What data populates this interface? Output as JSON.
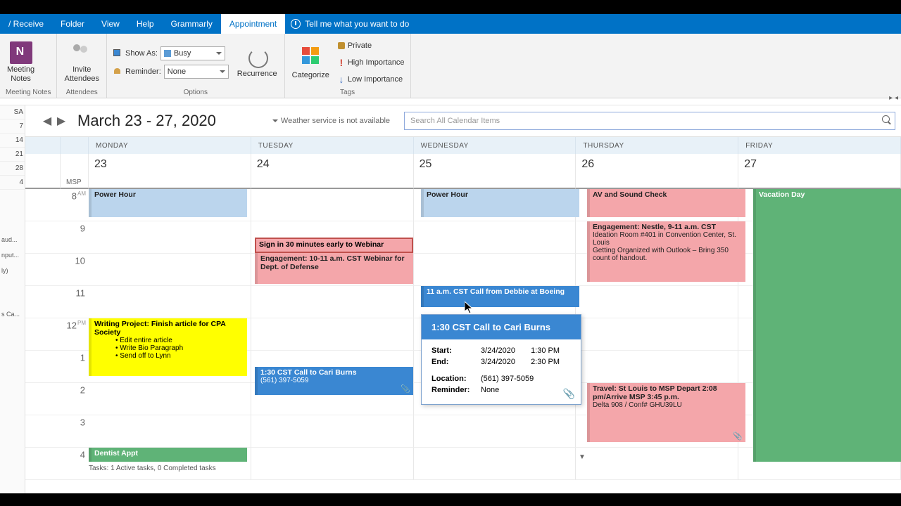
{
  "ribbon_tabs": {
    "send_receive": " / Receive",
    "folder": "Folder",
    "view": "View",
    "help": "Help",
    "grammarly": "Grammarly",
    "appointment": "Appointment",
    "tell_me": "Tell me what you want to do"
  },
  "ribbon": {
    "meeting_notes": "Meeting\nNotes",
    "meeting_notes_group": "Meeting Notes",
    "invite_attendees": "Invite\nAttendees",
    "attendees_group": "Attendees",
    "show_as_label": "Show As:",
    "show_as_value": "Busy",
    "reminder_label": "Reminder:",
    "reminder_value": "None",
    "recurrence": "Recurrence",
    "options_group": "Options",
    "categorize": "Categorize",
    "private": "Private",
    "high_importance": "High Importance",
    "low_importance": "Low Importance",
    "tags_group": "Tags"
  },
  "left": {
    "sa": "SA",
    "d7": "7",
    "d14": "14",
    "d21": "21",
    "d28": "28",
    "d4": "4",
    "aud": "aud...",
    "nput": "nput...",
    "ly": "ly)",
    "sca": "s Ca..."
  },
  "calendar": {
    "title": "March 23 - 27, 2020",
    "weather": "Weather service is not available",
    "search_placeholder": "Search All Calendar Items",
    "tz": "MSP",
    "days": {
      "mon": "MONDAY",
      "tue": "TUESDAY",
      "wed": "WEDNESDAY",
      "thu": "THURSDAY",
      "fri": "FRIDAY",
      "d23": "23",
      "d24": "24",
      "d25": "25",
      "d26": "26",
      "d27": "27"
    },
    "hours": {
      "h8": "8",
      "h9": "9",
      "h10": "10",
      "h11": "11",
      "h12": "12",
      "h1": "1",
      "h2": "2",
      "h3": "3",
      "h4": "4",
      "am": "AM",
      "pm": "PM"
    },
    "events": {
      "power_hour": "Power Hour",
      "signin": "Sign in 30 minutes early to Webinar",
      "dod": "Engagement: 10-11 a.m. CST Webinar for Dept. of Defense",
      "writing_t": "Writing Project: Finish article for CPA Society",
      "writing_1": "Edit entire article",
      "writing_2": "Write Bio Paragraph",
      "writing_3": "Send off to Lynn",
      "call_cari_t": "1:30 CST Call to Cari Burns",
      "call_cari_ph": "(561) 397-5059",
      "boeing": "11 a.m. CST Call from Debbie at Boeing",
      "av": "AV and Sound Check",
      "nestle_t": "Engagement: Nestle, 9-11 a.m. CST",
      "nestle_1": "Ideation Room #401 in Convention Center, St. Louis",
      "nestle_2": "Getting Organized with Outlook – Bring 350 count of handout.",
      "travel_t": "Travel: St Louis  to MSP  Depart 2:08 pm/Arrive MSP 3:45 p.m.",
      "travel_1": "Delta 908 / Conf# GHU39LU",
      "vacation": "Vacation Day",
      "dentist": "Dentist Appt"
    },
    "tasks": "Tasks: 1 Active tasks, 0 Completed tasks"
  },
  "popup": {
    "title": "1:30 CST Call to Cari Burns",
    "start_l": "Start:",
    "start_d": "3/24/2020",
    "start_t": "1:30 PM",
    "end_l": "End:",
    "end_d": "3/24/2020",
    "end_t": "2:30 PM",
    "loc_l": "Location:",
    "loc_v": "(561) 397-5059",
    "rem_l": "Reminder:",
    "rem_v": "None"
  }
}
